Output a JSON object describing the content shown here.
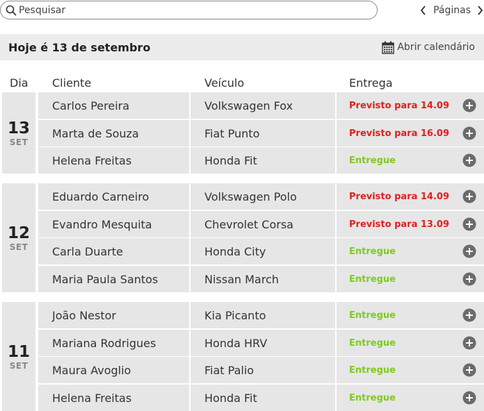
{
  "search": {
    "placeholder": "Pesquisar"
  },
  "pager": {
    "label": "Páginas"
  },
  "datebar": {
    "today": "Hoje é 13 de setembro",
    "calendar_label": "Abrir calendário"
  },
  "columns": {
    "day": "Dia",
    "client": "Cliente",
    "vehicle": "Veículo",
    "delivery": "Entrega"
  },
  "colors": {
    "late": "#e02020",
    "delivered": "#7ecb1f",
    "row_bg": "#e6e6e6"
  },
  "groups": [
    {
      "day": "13",
      "month": "SET",
      "rows": [
        {
          "client": "Carlos Pereira",
          "vehicle": "Volkswagen Fox",
          "delivery": "Previsto para 14.09",
          "status": "late"
        },
        {
          "client": "Marta de Souza",
          "vehicle": "Fiat Punto",
          "delivery": "Previsto para 16.09",
          "status": "late"
        },
        {
          "client": "Helena Freitas",
          "vehicle": "Honda Fit",
          "delivery": "Entregue",
          "status": "done"
        }
      ]
    },
    {
      "day": "12",
      "month": "SET",
      "rows": [
        {
          "client": "Eduardo Carneiro",
          "vehicle": "Volkswagen Polo",
          "delivery": "Previsto para 14.09",
          "status": "late"
        },
        {
          "client": "Evandro Mesquita",
          "vehicle": "Chevrolet Corsa",
          "delivery": "Previsto para 13.09",
          "status": "late"
        },
        {
          "client": "Carla Duarte",
          "vehicle": "Honda City",
          "delivery": "Entregue",
          "status": "done"
        },
        {
          "client": "Maria Paula Santos",
          "vehicle": "Nissan March",
          "delivery": "Entregue",
          "status": "done"
        }
      ]
    },
    {
      "day": "11",
      "month": "SET",
      "rows": [
        {
          "client": "João Nestor",
          "vehicle": "Kia Picanto",
          "delivery": "Entregue",
          "status": "done"
        },
        {
          "client": "Mariana Rodrigues",
          "vehicle": "Honda HRV",
          "delivery": "Entregue",
          "status": "done"
        },
        {
          "client": "Maura Avoglio",
          "vehicle": "Fiat Palio",
          "delivery": "Entregue",
          "status": "done"
        },
        {
          "client": "Helena Freitas",
          "vehicle": "Honda Fit",
          "delivery": "Entregue",
          "status": "done"
        }
      ]
    }
  ]
}
